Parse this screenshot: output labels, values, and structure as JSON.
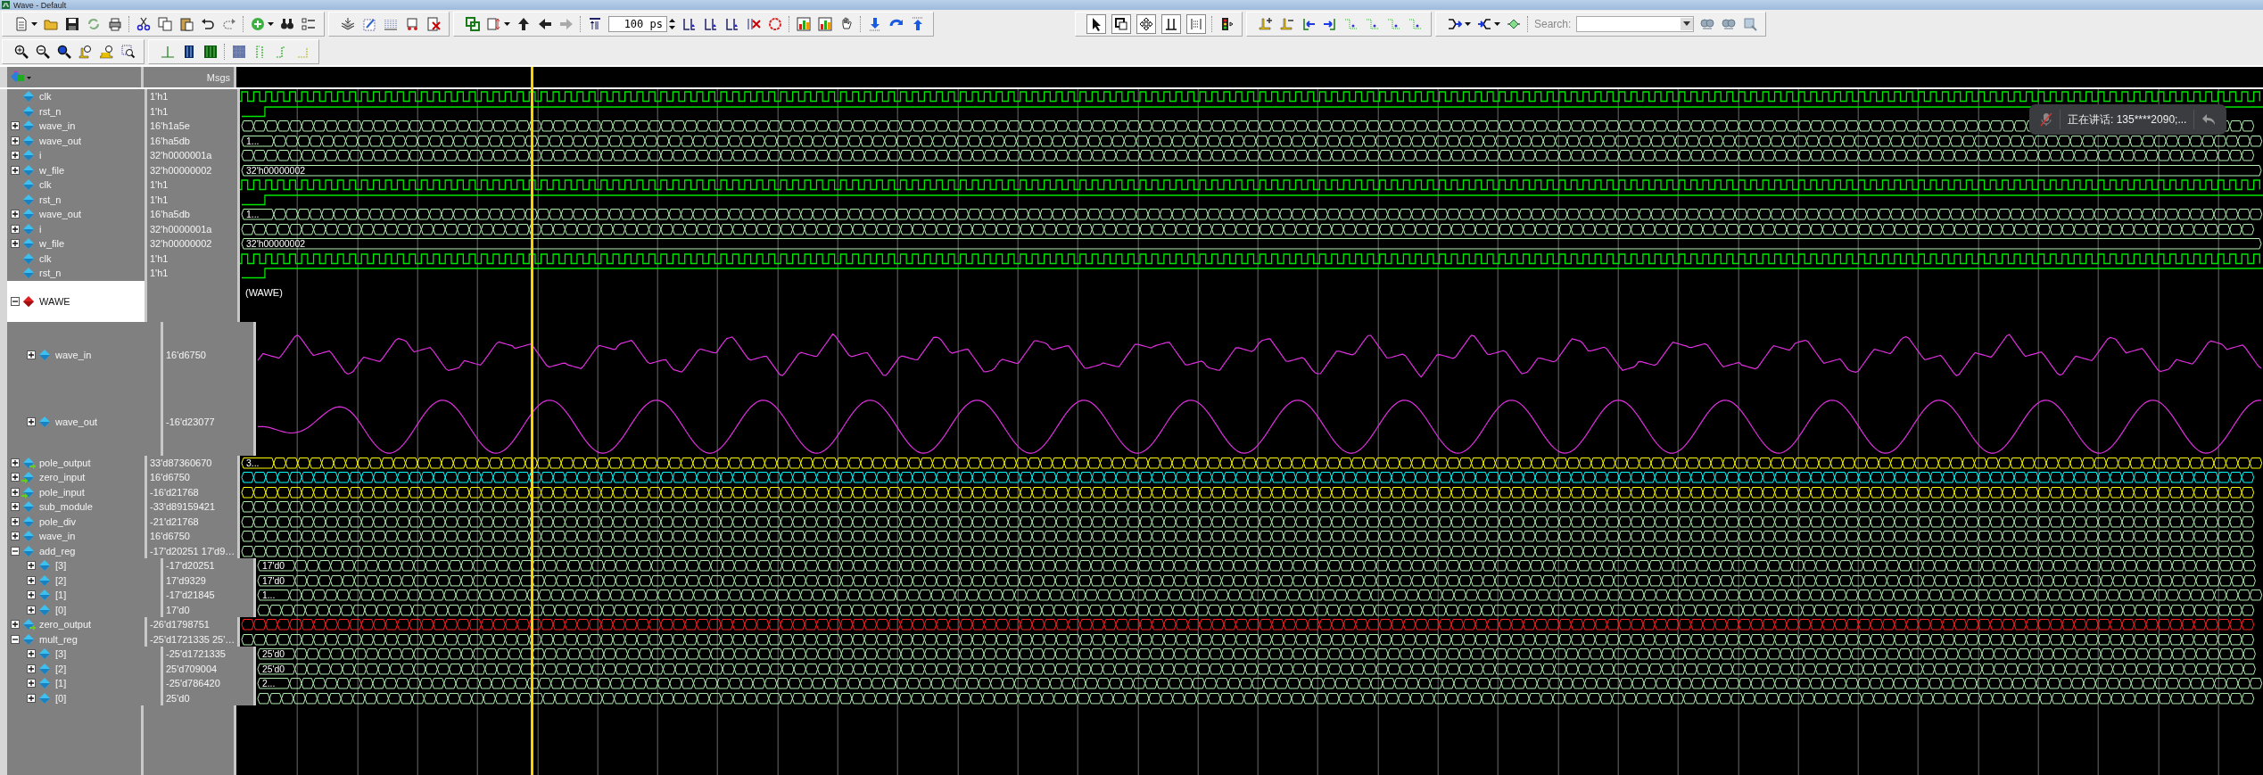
{
  "window": {
    "title": "Wave - Default"
  },
  "toolbar": {
    "time_step": "100 ps",
    "search_label": "Search:"
  },
  "wave_panel": {
    "value_header": "Msgs"
  },
  "signals": [
    {
      "name": "clk",
      "value": "1'h1",
      "kind": "clock",
      "selected": false
    },
    {
      "name": "rst_n",
      "value": "1'h1",
      "kind": "step",
      "selected": false
    },
    {
      "name": "wave_in",
      "value": "16'h1a5e",
      "kind": "bus",
      "color": "#b4f0b4",
      "expanded": false,
      "selected": false
    },
    {
      "name": "wave_out",
      "value": "16'ha5db",
      "kind": "bus",
      "color": "#b4f0b4",
      "label": "1...",
      "expanded": false,
      "selected": false
    },
    {
      "name": "i",
      "value": "32'h0000001a",
      "kind": "bus",
      "color": "#b4f0b4",
      "expanded": false,
      "selected": false
    },
    {
      "name": "w_file",
      "value": "32'h00000002",
      "kind": "bus",
      "color": "#b4f0b4",
      "label": "32'h00000002",
      "constant": true,
      "expanded": false,
      "selected": false
    },
    {
      "name": "clk",
      "value": "1'h1",
      "kind": "clock",
      "selected": false
    },
    {
      "name": "rst_n",
      "value": "1'h1",
      "kind": "step",
      "selected": false
    },
    {
      "name": "wave_out",
      "value": "16'ha5db",
      "kind": "bus",
      "color": "#b4f0b4",
      "label": "1...",
      "expanded": false,
      "selected": false
    },
    {
      "name": "i",
      "value": "32'h0000001a",
      "kind": "bus",
      "color": "#b4f0b4",
      "expanded": false,
      "selected": false
    },
    {
      "name": "w_file",
      "value": "32'h00000002",
      "kind": "bus",
      "color": "#b4f0b4",
      "label": "32'h00000002",
      "constant": true,
      "expanded": false,
      "selected": false
    },
    {
      "name": "clk",
      "value": "1'h1",
      "kind": "clock",
      "selected": false
    },
    {
      "name": "rst_n",
      "value": "1'h1",
      "kind": "step",
      "selected": false
    },
    {
      "name": "WAWE",
      "kind": "group",
      "wave_label": "(WAWE)",
      "expanded": true,
      "selected": true,
      "children": [
        {
          "name": "wave_in",
          "value": "16'd6750",
          "kind": "analog-tri",
          "expanded": false,
          "selected": false
        },
        {
          "name": "wave_out",
          "value": "-16'd23077",
          "kind": "analog-sine",
          "expanded": false,
          "selected": false
        }
      ]
    },
    {
      "name": "pole_output",
      "value": "33'd87360670",
      "kind": "bus",
      "color": "#ffff00",
      "label": "3...",
      "port_out": true,
      "expanded": false,
      "selected": false
    },
    {
      "name": "zero_input",
      "value": "16'd6750",
      "kind": "bus",
      "color": "#00ffff",
      "port_in": true,
      "expanded": false,
      "selected": false
    },
    {
      "name": "pole_input",
      "value": "-16'd21768",
      "kind": "bus",
      "color": "#ffff00",
      "port_in": true,
      "expanded": false,
      "selected": false
    },
    {
      "name": "sub_module",
      "value": "-33'd89159421",
      "kind": "bus",
      "color": "#b4f0b4",
      "expanded": false,
      "selected": false
    },
    {
      "name": "pole_div",
      "value": "-21'd21768",
      "kind": "bus",
      "color": "#b4f0b4",
      "expanded": false,
      "selected": false
    },
    {
      "name": "wave_in",
      "value": "16'd6750",
      "kind": "bus",
      "color": "#b4f0b4",
      "expanded": false,
      "selected": false
    },
    {
      "name": "add_reg",
      "value": "-17'd20251 17'd9…",
      "kind": "bus",
      "color": "#b4f0b4",
      "expanded": true,
      "selected": false,
      "children": [
        {
          "name": "[3]",
          "value": "-17'd20251",
          "kind": "bus",
          "color": "#b4f0b4",
          "label": "17'd0",
          "expanded": false,
          "selected": false
        },
        {
          "name": "[2]",
          "value": "17'd9329",
          "kind": "bus",
          "color": "#b4f0b4",
          "label": "17'd0",
          "expanded": false,
          "selected": false
        },
        {
          "name": "[1]",
          "value": "-17'd21845",
          "kind": "bus",
          "color": "#b4f0b4",
          "label": "1...",
          "expanded": false,
          "selected": false
        },
        {
          "name": "[0]",
          "value": "17'd0",
          "kind": "bus",
          "color": "#b4f0b4",
          "expanded": false,
          "selected": false
        }
      ]
    },
    {
      "name": "zero_output",
      "value": "-26'd1798751",
      "kind": "bus",
      "color": "#ff2020",
      "port_out": true,
      "expanded": false,
      "selected": false
    },
    {
      "name": "mult_reg",
      "value": "-25'd1721335 25'…",
      "kind": "bus",
      "color": "#b4f0b4",
      "expanded": true,
      "selected": false,
      "children": [
        {
          "name": "[3]",
          "value": "-25'd1721335",
          "kind": "bus",
          "color": "#b4f0b4",
          "label": "25'd0",
          "expanded": false,
          "selected": false
        },
        {
          "name": "[2]",
          "value": "25'd709004",
          "kind": "bus",
          "color": "#b4f0b4",
          "label": "25'd0",
          "expanded": false,
          "selected": false
        },
        {
          "name": "[1]",
          "value": "-25'd786420",
          "kind": "bus",
          "color": "#b4f0b4",
          "label": "2...",
          "expanded": false,
          "selected": false
        },
        {
          "name": "[0]",
          "value": "25'd0",
          "kind": "bus",
          "color": "#b4f0b4",
          "expanded": false,
          "selected": false
        }
      ]
    }
  ],
  "call_banner": {
    "text": "正在讲话: 135****2090;..."
  }
}
